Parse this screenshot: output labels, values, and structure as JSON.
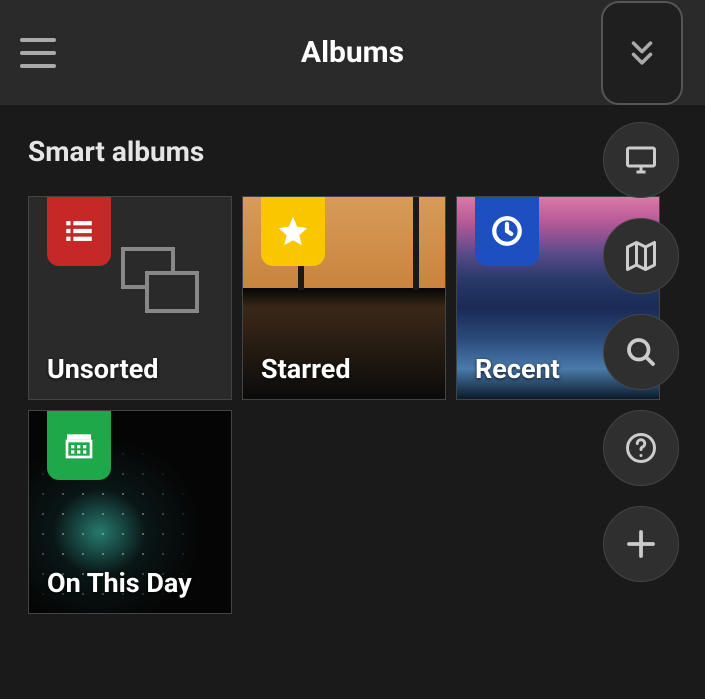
{
  "header": {
    "title": "Albums"
  },
  "section": {
    "title": "Smart albums"
  },
  "albums": [
    {
      "label": "Unsorted",
      "badge_color": "#c62828",
      "badge_icon": "list"
    },
    {
      "label": "Starred",
      "badge_color": "#f9c600",
      "badge_icon": "star"
    },
    {
      "label": "Recent",
      "badge_color": "#1e4fc1",
      "badge_icon": "clock"
    },
    {
      "label": "On This Day",
      "badge_color": "#1ea84a",
      "badge_icon": "calendar"
    }
  ],
  "fabs": [
    {
      "name": "display",
      "icon": "monitor"
    },
    {
      "name": "map",
      "icon": "map"
    },
    {
      "name": "search",
      "icon": "search"
    },
    {
      "name": "help",
      "icon": "help"
    },
    {
      "name": "add",
      "icon": "plus"
    }
  ]
}
